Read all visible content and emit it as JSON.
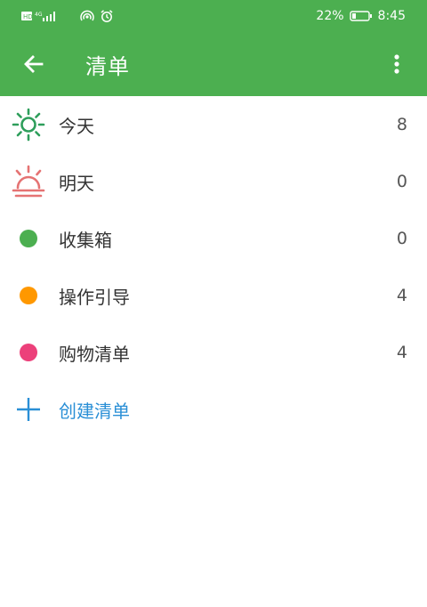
{
  "status_bar": {
    "left_text": "HD 4G",
    "battery": "22%",
    "time": "8:45"
  },
  "appbar": {
    "title": "清单"
  },
  "lists": [
    {
      "label": "今天",
      "count": "8",
      "icon": "sun-icon",
      "color": "#2e9e5b"
    },
    {
      "label": "明天",
      "count": "0",
      "icon": "sunrise-icon",
      "color": "#e57373"
    },
    {
      "label": "收集箱",
      "count": "0",
      "icon": "dot-icon",
      "color": "#4caf50"
    },
    {
      "label": "操作引导",
      "count": "4",
      "icon": "dot-icon",
      "color": "#ff9800"
    },
    {
      "label": "购物清单",
      "count": "4",
      "icon": "dot-icon",
      "color": "#ec407a"
    }
  ],
  "create": {
    "label": "创建清单",
    "color": "#2a8fd6"
  }
}
